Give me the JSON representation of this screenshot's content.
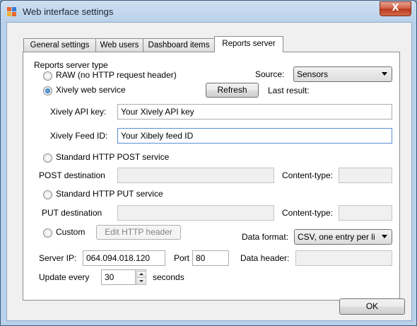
{
  "window": {
    "title": "Web interface settings",
    "close_glyph": "X"
  },
  "tabs": [
    {
      "label": "General settings"
    },
    {
      "label": "Web users"
    },
    {
      "label": "Dashboard items"
    },
    {
      "label": "Reports server",
      "active": true
    }
  ],
  "reports": {
    "group_label": "Reports server type",
    "raw_label": "RAW (no HTTP request header)",
    "xively_label": "Xively web service",
    "source_label": "Source:",
    "source_value": "Sensors",
    "refresh_label": "Refresh",
    "last_result_label": "Last result:",
    "api_key_label": "Xively API key:",
    "api_key_value": "Your Xively API key",
    "feed_id_label": "Xively Feed ID:",
    "feed_id_value": "Your Xibely feed ID",
    "post_label": "Standard HTTP POST service",
    "post_dest_label": "POST destination",
    "content_type_label": "Content-type:",
    "put_label": "Standard HTTP PUT service",
    "put_dest_label": "PUT destination",
    "custom_label": "Custom",
    "edit_header_label": "Edit HTTP header",
    "data_format_label": "Data format:",
    "data_format_value": "CSV, one entry per li",
    "server_ip_label": "Server IP:",
    "server_ip_value": "064.094.018.120",
    "port_label": "Port",
    "port_value": "80",
    "data_header_label": "Data header:",
    "update_every_label": "Update every",
    "update_every_value": "30",
    "seconds_label": "seconds",
    "selected_type": "xively"
  },
  "ok_label": "OK"
}
